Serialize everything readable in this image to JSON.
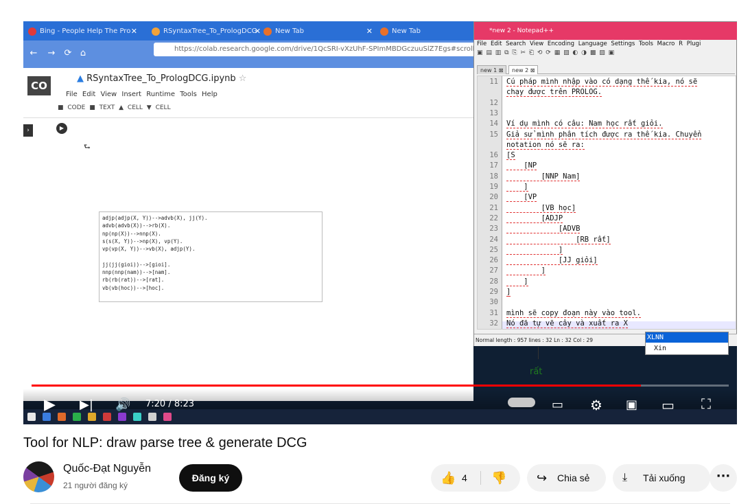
{
  "browser": {
    "tabs": [
      {
        "label": "Bing - People Help The Pro",
        "color": "#e03a3a"
      },
      {
        "label": "RSyntaxTree_To_PrologDCG",
        "color": "#f2a33a"
      },
      {
        "label": "New Tab",
        "color": "#e8702a"
      },
      {
        "label": "New Tab",
        "color": "#e8702a"
      }
    ],
    "url": "https://colab.research.google.com/drive/1QcSRI-vXzUhF-SPImMBDGczuuSlZ7Egs#scrollTo"
  },
  "colab": {
    "logo": "CO",
    "notebook_title": "RSyntaxTree_To_PrologDCG.ipynb",
    "menu": [
      "File",
      "Edit",
      "View",
      "Insert",
      "Runtime",
      "Tools",
      "Help"
    ],
    "toolbar": [
      "CODE",
      "TEXT",
      "CELL",
      "CELL"
    ],
    "code_output": [
      "adjp(adjp(X, Y))-->advb(X), jj(Y).",
      "advb(advb(X))-->rb(X).",
      "np(np(X))-->nnp(X).",
      "s(s(X, Y))-->np(X), vp(Y).",
      "vp(vp(X, Y))-->vb(X), adjp(Y).",
      "",
      "jj(jj(gioi))-->[gioi].",
      "nnp(nnp(nam))-->[nam].",
      "rb(rb(rat))-->[rat].",
      "vb(vb(hoc))-->[hoc]."
    ]
  },
  "notepad": {
    "title": "*new 2 - Notepad++",
    "menu": [
      "File",
      "Edit",
      "Search",
      "View",
      "Encoding",
      "Language",
      "Settings",
      "Tools",
      "Macro",
      "R",
      "Plugi"
    ],
    "tabs": [
      "new 1",
      "new 2"
    ],
    "lines": [
      {
        "n": "11",
        "t": "Cú pháp mình nhập vào có dạng thế kia, nó sẽ"
      },
      {
        "n": "",
        "t": "chạy được trên PROLOG."
      },
      {
        "n": "12",
        "t": ""
      },
      {
        "n": "13",
        "t": ""
      },
      {
        "n": "14",
        "t": "Ví dụ mình có câu: Nam học rất giỏi."
      },
      {
        "n": "15",
        "t": "Giả sử mình phân tích được ra thế kia. Chuyển"
      },
      {
        "n": "",
        "t": "notation nó sẽ ra:"
      },
      {
        "n": "16",
        "t": "[S"
      },
      {
        "n": "17",
        "t": "    [NP"
      },
      {
        "n": "18",
        "t": "        [NNP Nam]"
      },
      {
        "n": "19",
        "t": "    ]"
      },
      {
        "n": "20",
        "t": "    [VP"
      },
      {
        "n": "21",
        "t": "        [VB học]"
      },
      {
        "n": "22",
        "t": "        [ADJP"
      },
      {
        "n": "23",
        "t": "            [ADVB"
      },
      {
        "n": "24",
        "t": "                [RB rất]"
      },
      {
        "n": "25",
        "t": "            ]"
      },
      {
        "n": "26",
        "t": "            [JJ giỏi]"
      },
      {
        "n": "27",
        "t": "        ]"
      },
      {
        "n": "28",
        "t": "    ]"
      },
      {
        "n": "29",
        "t": "]"
      },
      {
        "n": "30",
        "t": ""
      },
      {
        "n": "31",
        "t": "mình sẽ copy đoạn này vào tool."
      },
      {
        "n": "32",
        "t": "Nó đã tự vẽ cây và xuất ra X"
      }
    ],
    "status": "Normal length : 957    lines : 32               Ln : 32    Col : 29",
    "autocomplete": [
      "XLNN",
      "Xin"
    ]
  },
  "tree_word": "rất",
  "player": {
    "time": "7:20 / 8:23",
    "progress": 0.874,
    "colors": {
      "progress": "#ff0000"
    }
  },
  "video": {
    "title": "Tool for NLP: draw parse tree & generate DCG",
    "channel": "Quốc-Đạt Nguyễn",
    "subscribers": "21 người đăng ký",
    "subscribe_label": "Đăng ký",
    "likes": "4",
    "share_label": "Chia sẻ",
    "download_label": "Tải xuống",
    "more_label": "···"
  }
}
